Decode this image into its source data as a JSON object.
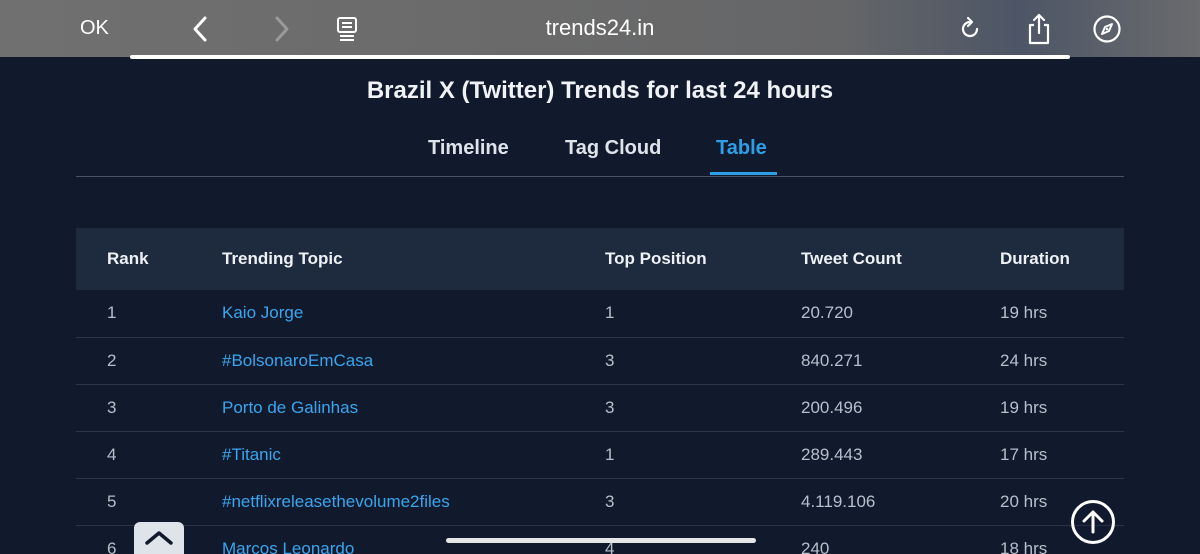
{
  "browser": {
    "done_label": "OK",
    "url": "trends24.in",
    "icons": [
      "chevron-left-icon",
      "chevron-right-icon",
      "reader-icon",
      "reload-icon",
      "share-icon",
      "compass-icon"
    ]
  },
  "page": {
    "title": "Brazil X (Twitter) Trends for last 24 hours",
    "tabs": [
      {
        "label": "Timeline",
        "active": false
      },
      {
        "label": "Tag Cloud",
        "active": false
      },
      {
        "label": "Table",
        "active": true
      }
    ]
  },
  "table": {
    "headers": [
      "Rank",
      "Trending Topic",
      "Top Position",
      "Tweet Count",
      "Duration"
    ],
    "rows": [
      {
        "rank": "1",
        "topic": "Kaio Jorge",
        "top_position": "1",
        "tweet_count": "20.720",
        "duration": "19 hrs"
      },
      {
        "rank": "2",
        "topic": "#BolsonaroEmCasa",
        "top_position": "3",
        "tweet_count": "840.271",
        "duration": "24 hrs"
      },
      {
        "rank": "3",
        "topic": "Porto de Galinhas",
        "top_position": "3",
        "tweet_count": "200.496",
        "duration": "19 hrs"
      },
      {
        "rank": "4",
        "topic": "#Titanic",
        "top_position": "1",
        "tweet_count": "289.443",
        "duration": "17 hrs"
      },
      {
        "rank": "5",
        "topic": "#netflixreleasethevolume2files",
        "top_position": "3",
        "tweet_count": "4.119.106",
        "duration": "20 hrs"
      },
      {
        "rank": "6",
        "topic": "Marcos Leonardo",
        "top_position": "4",
        "tweet_count": "240",
        "duration": "18 hrs"
      }
    ]
  },
  "colors": {
    "background": "#111a2d",
    "accent": "#2e9fe6",
    "header_row": "#1e2a3d",
    "link": "#3aa5ee"
  }
}
